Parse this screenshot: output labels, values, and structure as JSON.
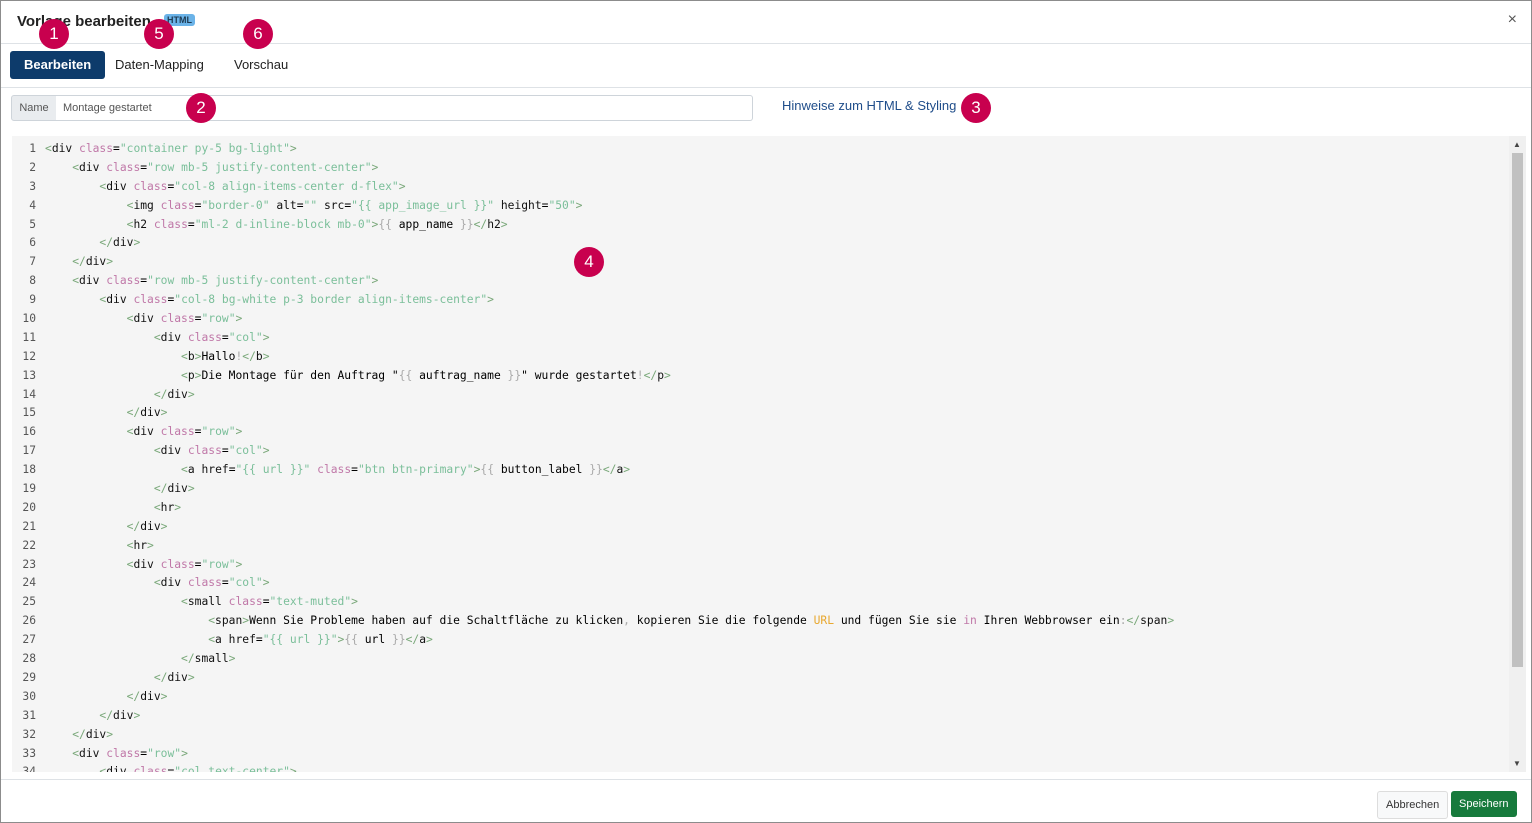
{
  "dialog": {
    "title": "Vorlage bearbeiten",
    "badge": "HTML",
    "close_label": "×"
  },
  "tabs": [
    {
      "label": "Bearbeiten",
      "active": true
    },
    {
      "label": "Daten-Mapping",
      "active": false
    },
    {
      "label": "Vorschau",
      "active": false
    }
  ],
  "name_field": {
    "label": "Name",
    "value": "Montage gestartet"
  },
  "hint_link": "Hinweise zum HTML & Styling",
  "editor": {
    "language": "html",
    "lines": [
      "<div class=\"container py-5 bg-light\">",
      "    <div class=\"row mb-5 justify-content-center\">",
      "        <div class=\"col-8 align-items-center d-flex\">",
      "            <img class=\"border-0\" alt=\"\" src=\"{{ app_image_url }}\" height=\"50\">",
      "            <h2 class=\"ml-2 d-inline-block mb-0\">{{ app_name }}</h2>",
      "        </div>",
      "    </div>",
      "    <div class=\"row mb-5 justify-content-center\">",
      "        <div class=\"col-8 bg-white p-3 border align-items-center\">",
      "            <div class=\"row\">",
      "                <div class=\"col\">",
      "                    <b>Hallo!</b>",
      "                    <p>Die Montage für den Auftrag \"{{ auftrag_name }}\" wurde gestartet!</p>",
      "                </div>",
      "            </div>",
      "            <div class=\"row\">",
      "                <div class=\"col\">",
      "                    <a href=\"{{ url }}\" class=\"btn btn-primary\">{{ button_label }}</a>",
      "                </div>",
      "                <hr>",
      "            </div>",
      "            <hr>",
      "            <div class=\"row\">",
      "                <div class=\"col\">",
      "                    <small class=\"text-muted\">",
      "                        <span>Wenn Sie Probleme haben auf die Schaltfläche zu klicken, kopieren Sie die folgende URL und fügen Sie sie in Ihren Webbrowser ein:</span>",
      "                        <a href=\"{{ url }}\">{{ url }}</a>",
      "                    </small>",
      "                </div>",
      "            </div>",
      "        </div>",
      "    </div>",
      "    <div class=\"row\">",
      "        <div class=\"col text-center\">"
    ]
  },
  "markers": [
    "1",
    "2",
    "3",
    "4",
    "5",
    "6"
  ],
  "footer": {
    "cancel_label": "Abbrechen",
    "save_label": "Speichern"
  },
  "colors": {
    "primary_tab": "#0d3b6b",
    "save_button": "#177a3c",
    "marker": "#c8004e",
    "link": "#1f4d8a",
    "badge": "#6bb3e8"
  }
}
